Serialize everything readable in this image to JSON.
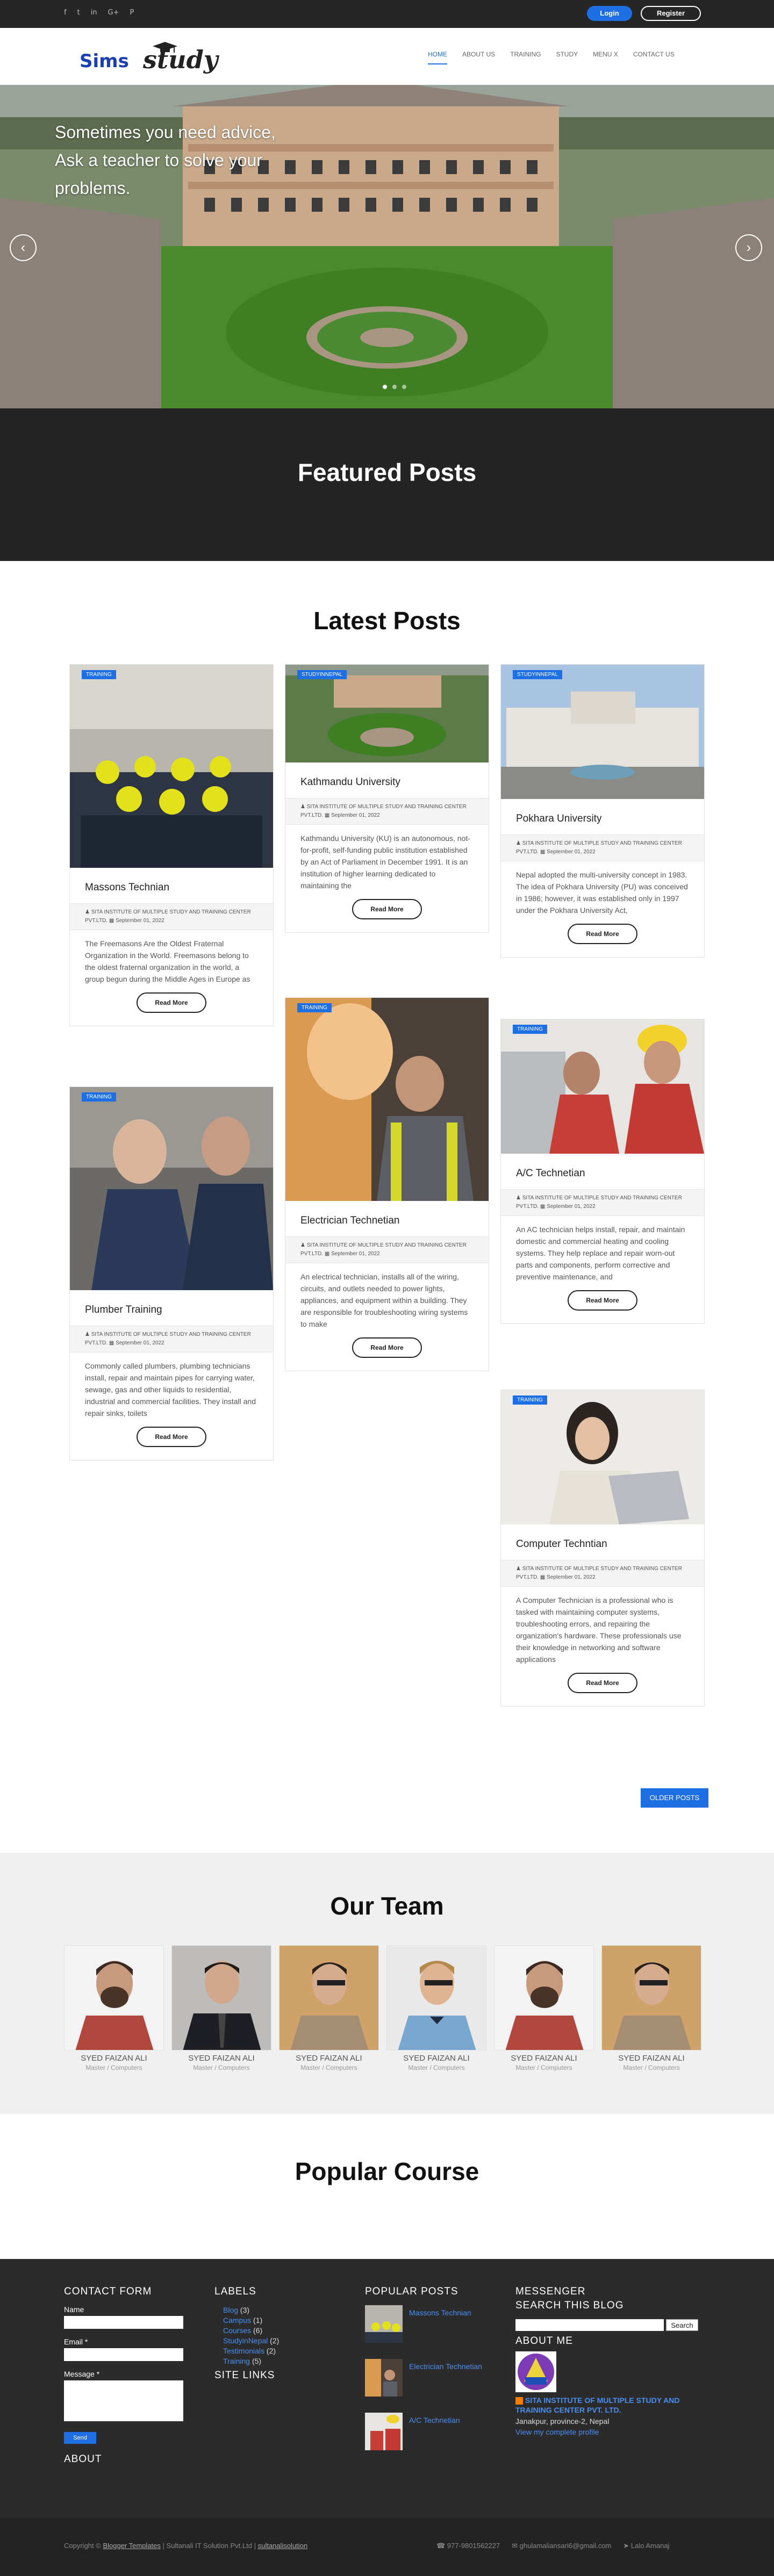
{
  "topbar": {
    "social": [
      "f",
      "t",
      "in",
      "G+",
      "P"
    ],
    "social_icons": [
      "facebook-icon",
      "twitter-icon",
      "linkedin-icon",
      "google-plus-icon",
      "pinterest-icon"
    ],
    "login": "Login",
    "register": "Register"
  },
  "logo": {
    "part1": "Sims",
    "part2": "study"
  },
  "nav": [
    "HOME",
    "ABOUT US",
    "TRAINING",
    "STUDY",
    "MENU X",
    "CONTACT US"
  ],
  "hero": {
    "text": "Sometimes you need advice, Ask a teacher to solve your problems.",
    "prev": "‹",
    "next": "›"
  },
  "featured": {
    "title": "Featured Posts"
  },
  "latest": {
    "title": "Latest Posts"
  },
  "posts": [
    {
      "badge": "TRAINING",
      "title": "Massons Technian",
      "author": "SITA INSTITUTE OF MULTIPLE STUDY AND TRAINING CENTER PVT.LTD.",
      "date": "September 01, 2022",
      "excerpt": "The Freemasons Are the Oldest Fraternal Organization in the World. Freemasons belong to the oldest fraternal organization in the world, a group begun during the Middle Ages in Europe as",
      "read": "Read More"
    },
    {
      "badge": "STUDYINNEPAL",
      "title": "Kathmandu University",
      "author": "SITA INSTITUTE OF MULTIPLE STUDY AND TRAINING CENTER PVT.LTD.",
      "date": "September 01, 2022",
      "excerpt": "Kathmandu University (KU) is an autonomous, not-for-profit, self-funding public institution established by an Act of Parliament in December 1991. It is an institution of higher learning dedicated to maintaining the",
      "read": "Read More"
    },
    {
      "badge": "STUDYINNEPAL",
      "title": "Pokhara University",
      "author": "SITA INSTITUTE OF MULTIPLE STUDY AND TRAINING CENTER PVT.LTD.",
      "date": "September 01, 2022",
      "excerpt": "Nepal adopted the multi-university concept in 1983. The idea of Pokhara University (PU) was conceived in 1986; however, it was established only in 1997 under the Pokhara University Act,",
      "read": "Read More"
    },
    {
      "badge": "TRAINING",
      "title": "Plumber Training",
      "author": "SITA INSTITUTE OF MULTIPLE STUDY AND TRAINING CENTER PVT.LTD.",
      "date": "September 01, 2022",
      "excerpt": "Commonly called plumbers, plumbing technicians install, repair and maintain pipes for carrying water, sewage, gas and other liquids to residential, industrial and commercial facilities. They install and repair sinks, toilets",
      "read": "Read More"
    },
    {
      "badge": "TRAINING",
      "title": "Electrician Technetian",
      "author": "SITA INSTITUTE OF MULTIPLE STUDY AND TRAINING CENTER PVT.LTD.",
      "date": "September 01, 2022",
      "excerpt": "An electrical technician, installs all of the wiring, circuits, and outlets needed to power lights, appliances, and equipment within a building. They are responsible for troubleshooting wiring systems to make",
      "read": "Read More"
    },
    {
      "badge": "TRAINING",
      "title": "A/C Technetian",
      "author": "SITA INSTITUTE OF MULTIPLE STUDY AND TRAINING CENTER PVT.LTD.",
      "date": "September 01, 2022",
      "excerpt": "An AC technician helps install, repair, and maintain domestic and commercial heating and cooling systems. They help replace and repair worn-out parts and components, perform corrective and preventive maintenance, and",
      "read": "Read More"
    },
    {
      "badge": "TRAINING",
      "title": "Computer Techntian",
      "author": "SITA INSTITUTE OF MULTIPLE STUDY AND TRAINING CENTER PVT.LTD.",
      "date": "September 01, 2022",
      "excerpt": "A Computer Technician is a professional who is tasked with maintaining computer systems, troubleshooting errors, and repairing the organization's hardware. These professionals use their knowledge in networking and software applications",
      "read": "Read More"
    }
  ],
  "older_posts": "OLDER POSTS",
  "team": {
    "title": "Our Team",
    "members": [
      {
        "name": "SYED FAIZAN ALI",
        "role": "Master / Computers"
      },
      {
        "name": "SYED FAIZAN ALI",
        "role": "Master / Computers"
      },
      {
        "name": "SYED FAIZAN ALI",
        "role": "Master / Computers"
      },
      {
        "name": "SYED FAIZAN ALI",
        "role": "Master / Computers"
      },
      {
        "name": "SYED FAIZAN ALI",
        "role": "Master / Computers"
      },
      {
        "name": "SYED FAIZAN ALI",
        "role": "Master / Computers"
      }
    ]
  },
  "popular": {
    "title": "Popular Course"
  },
  "footer": {
    "contact_form": "CONTACT FORM",
    "name_label": "Name",
    "email_label": "Email *",
    "message_label": "Message *",
    "send": "Send",
    "about": "ABOUT",
    "labels_title": "LABELS",
    "labels": [
      {
        "name": "Blog",
        "count": "(3)"
      },
      {
        "name": "Campus",
        "count": "(1)"
      },
      {
        "name": "Courses",
        "count": "(6)"
      },
      {
        "name": "StudyinNepal",
        "count": "(2)"
      },
      {
        "name": "Testimonials",
        "count": "(2)"
      },
      {
        "name": "Training",
        "count": "(5)"
      }
    ],
    "site_links": "SITE LINKS",
    "popular_posts_title": "POPULAR POSTS",
    "popular_posts": [
      "Massons Technian",
      "Electrician Technetian",
      "A/C Technetian"
    ],
    "messenger": "MESSENGER",
    "search_title": "SEARCH THIS BLOG",
    "search_btn": "Search",
    "about_me": "ABOUT ME",
    "org_name": "SITA INSTITUTE OF MULTIPLE STUDY AND TRAINING CENTER PVT. LTD.",
    "address": "Janakpur, province-2, Nepal",
    "profile_link": "View my complete profile"
  },
  "bottom": {
    "copyright_prefix": "Copyright ©",
    "copyright_link": "Blogger Templates",
    "copyright_mid": "| Sultanali IT Solution Pvt.Ltd |",
    "copyright_link2": "sultanalisolution",
    "phone": "977-9801562227",
    "email": "ghulamaliansari6@gmail.com",
    "location": "Lalo Amanaj"
  },
  "colors": {
    "accent": "#1d6fe3",
    "dark": "#242424",
    "footer": "#2b2b2b"
  }
}
